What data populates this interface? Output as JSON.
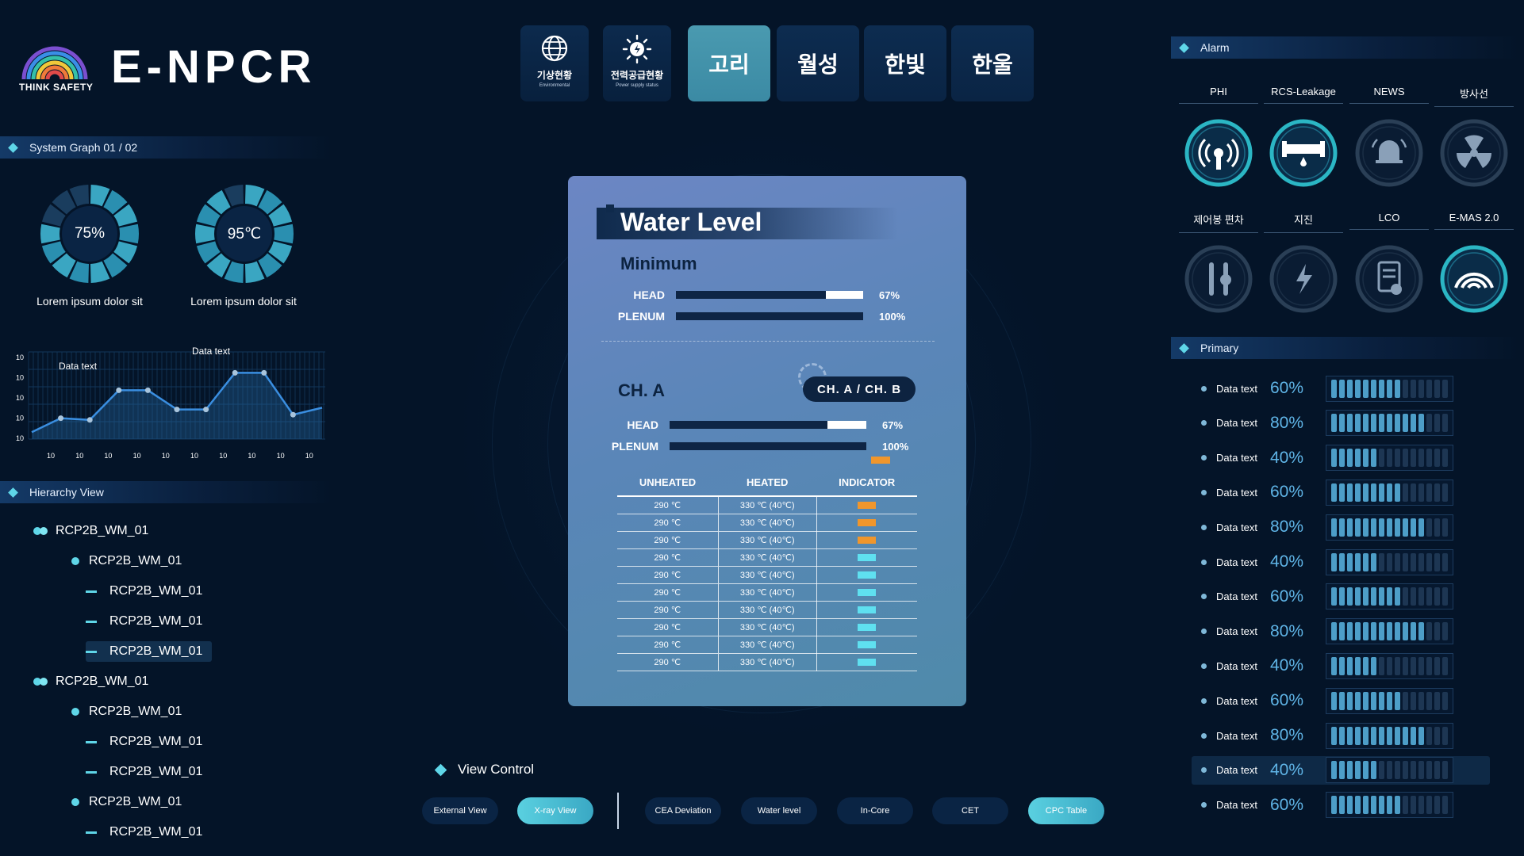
{
  "app": {
    "title": "E-NPCR",
    "tagline": "THINK SAFETY"
  },
  "nav": {
    "icon_buttons": [
      {
        "label": "기상현황",
        "sub": "Environmental",
        "icon": "globe-icon"
      },
      {
        "label": "전력공급현황",
        "sub": "Power supply status",
        "icon": "power-sun-icon"
      }
    ],
    "tabs": [
      {
        "label": "고리",
        "active": true
      },
      {
        "label": "월성",
        "active": false
      },
      {
        "label": "한빛",
        "active": false
      },
      {
        "label": "한울",
        "active": false
      }
    ]
  },
  "system_graph": {
    "title": "System Graph 01 / 02",
    "gauges": [
      {
        "value": "75%",
        "fraction": 0.75,
        "caption": "Lorem ipsum dolor sit"
      },
      {
        "value": "95℃",
        "fraction": 0.95,
        "caption": "Lorem ipsum dolor sit"
      }
    ]
  },
  "chart_data": {
    "type": "line",
    "x": [
      1,
      2,
      3,
      4,
      5,
      6,
      7,
      8,
      9,
      10,
      11
    ],
    "values": [
      4,
      12,
      11,
      28,
      28,
      17,
      17,
      38,
      38,
      14,
      18
    ],
    "x_tick_labels": [
      "10",
      "10",
      "10",
      "10",
      "10",
      "10",
      "10",
      "10",
      "10",
      "10"
    ],
    "y_tick_labels": [
      "10",
      "10",
      "10",
      "10",
      "10"
    ],
    "annotations": [
      "Data text",
      "Data text"
    ],
    "ylim": [
      0,
      50
    ],
    "grid": true
  },
  "hierarchy": {
    "title": "Hierarchy View",
    "items": [
      {
        "label": "RCP2B_WM_01",
        "level": 0
      },
      {
        "label": "RCP2B_WM_01",
        "level": 1
      },
      {
        "label": "RCP2B_WM_01",
        "level": 2
      },
      {
        "label": "RCP2B_WM_01",
        "level": 2
      },
      {
        "label": "RCP2B_WM_01",
        "level": 2,
        "selected": true
      },
      {
        "label": "RCP2B_WM_01",
        "level": 0
      },
      {
        "label": "RCP2B_WM_01",
        "level": 1
      },
      {
        "label": "RCP2B_WM_01",
        "level": 2
      },
      {
        "label": "RCP2B_WM_01",
        "level": 2
      },
      {
        "label": "RCP2B_WM_01",
        "level": 1
      },
      {
        "label": "RCP2B_WM_01",
        "level": 2
      }
    ]
  },
  "water_level": {
    "title": "Water Level",
    "minimum": {
      "title": "Minimum",
      "rows": [
        {
          "label": "HEAD",
          "pct": "67%",
          "fraction": 0.67
        },
        {
          "label": "PLENUM",
          "pct": "100%",
          "fraction": 1.0
        }
      ]
    },
    "channel": {
      "title": "CH. A",
      "toggle_label": "CH. A  /  CH. B",
      "rows": [
        {
          "label": "HEAD",
          "pct": "67%",
          "fraction": 0.67
        },
        {
          "label": "PLENUM",
          "pct": "100%",
          "fraction": 1.0
        }
      ]
    },
    "table": {
      "headers": [
        "UNHEATED",
        "HEATED",
        "INDICATOR"
      ],
      "rows": [
        {
          "unheated": "290 ℃",
          "heated": "330 ℃ (40℃)",
          "indicator": "orange"
        },
        {
          "unheated": "290 ℃",
          "heated": "330 ℃ (40℃)",
          "indicator": "orange"
        },
        {
          "unheated": "290 ℃",
          "heated": "330 ℃ (40℃)",
          "indicator": "orange"
        },
        {
          "unheated": "290 ℃",
          "heated": "330 ℃ (40℃)",
          "indicator": "cyan"
        },
        {
          "unheated": "290 ℃",
          "heated": "330 ℃ (40℃)",
          "indicator": "cyan"
        },
        {
          "unheated": "290 ℃",
          "heated": "330 ℃ (40℃)",
          "indicator": "cyan"
        },
        {
          "unheated": "290 ℃",
          "heated": "330 ℃ (40℃)",
          "indicator": "cyan"
        },
        {
          "unheated": "290 ℃",
          "heated": "330 ℃ (40℃)",
          "indicator": "cyan"
        },
        {
          "unheated": "290 ℃",
          "heated": "330 ℃ (40℃)",
          "indicator": "cyan"
        },
        {
          "unheated": "290 ℃",
          "heated": "330 ℃ (40℃)",
          "indicator": "cyan"
        }
      ]
    }
  },
  "view_control": {
    "title": "View Control",
    "buttons": [
      {
        "label": "External View",
        "active": false
      },
      {
        "label": "X-ray View",
        "active": true
      },
      {
        "label": "CEA Deviation",
        "active": false
      },
      {
        "label": "Water level",
        "active": false
      },
      {
        "label": "In-Core",
        "active": false
      },
      {
        "label": "CET",
        "active": false
      },
      {
        "label": "CPC Table",
        "active": true
      }
    ]
  },
  "alarm": {
    "title": "Alarm",
    "items": [
      {
        "label": "PHI",
        "icon": "antenna-icon",
        "active": true
      },
      {
        "label": "RCS-Leakage",
        "icon": "pipe-leak-icon",
        "active": true
      },
      {
        "label": "NEWS",
        "icon": "bell-icon",
        "active": false
      },
      {
        "label": "방사선",
        "icon": "radiation-icon",
        "active": false
      },
      {
        "label": "제어봉 편차",
        "icon": "control-rod-icon",
        "active": false
      },
      {
        "label": "지진",
        "icon": "earthquake-icon",
        "active": false
      },
      {
        "label": "LCO",
        "icon": "document-check-icon",
        "active": false
      },
      {
        "label": "E-MAS 2.0",
        "icon": "signal-arc-icon",
        "active": true
      }
    ]
  },
  "primary": {
    "title": "Primary",
    "rows": [
      {
        "label": "Data text",
        "value": "60%",
        "fraction": 0.6
      },
      {
        "label": "Data text",
        "value": "80%",
        "fraction": 0.8
      },
      {
        "label": "Data text",
        "value": "40%",
        "fraction": 0.4
      },
      {
        "label": "Data text",
        "value": "60%",
        "fraction": 0.6
      },
      {
        "label": "Data text",
        "value": "80%",
        "fraction": 0.8
      },
      {
        "label": "Data text",
        "value": "40%",
        "fraction": 0.4
      },
      {
        "label": "Data text",
        "value": "60%",
        "fraction": 0.6
      },
      {
        "label": "Data text",
        "value": "80%",
        "fraction": 0.8
      },
      {
        "label": "Data text",
        "value": "40%",
        "fraction": 0.4
      },
      {
        "label": "Data text",
        "value": "60%",
        "fraction": 0.6
      },
      {
        "label": "Data text",
        "value": "80%",
        "fraction": 0.8
      },
      {
        "label": "Data text",
        "value": "40%",
        "fraction": 0.4,
        "selected": true
      },
      {
        "label": "Data text",
        "value": "60%",
        "fraction": 0.6
      }
    ]
  },
  "colors": {
    "background": "#041428",
    "accent": "#5fd6e8",
    "panel": "#5a86b8",
    "indicator_orange": "#f0962c",
    "indicator_cyan": "#5fe0f0"
  }
}
